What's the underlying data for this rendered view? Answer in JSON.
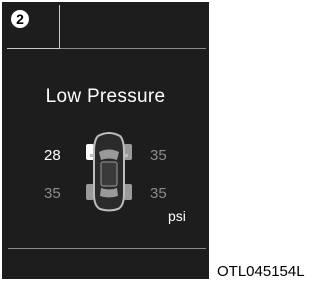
{
  "screen": {
    "step_badge": "2",
    "title": "Low Pressure",
    "tires": {
      "front_left": "28",
      "front_right": "35",
      "rear_left": "35",
      "rear_right": "35"
    },
    "low_tire": "front_left",
    "unit": "psi",
    "icon": "car-top-view-icon"
  },
  "caption": "OTL045154L",
  "colors": {
    "screen_bg": "#1d1d1d",
    "low_value": "#ffffff",
    "normal_value": "#8b8b8b"
  }
}
